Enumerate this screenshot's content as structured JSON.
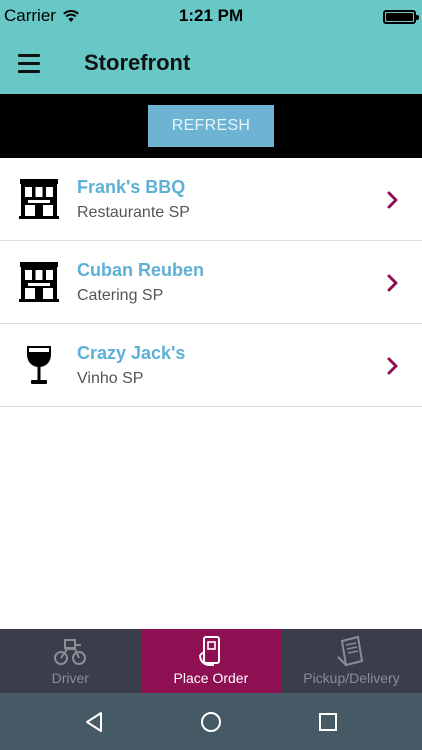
{
  "status_bar": {
    "carrier": "Carrier",
    "time": "1:21 PM",
    "icons": [
      "wifi-icon",
      "battery-icon"
    ]
  },
  "app_bar": {
    "title": "Storefront",
    "menu_icon": "hamburger-menu-icon"
  },
  "refresh": {
    "label": "REFRESH"
  },
  "stores": [
    {
      "name": "Frank's BBQ",
      "subtitle": "Restaurante SP",
      "icon": "storefront-building-icon"
    },
    {
      "name": "Cuban Reuben",
      "subtitle": "Catering SP",
      "icon": "storefront-building-icon"
    },
    {
      "name": "Crazy Jack's",
      "subtitle": "Vinho SP",
      "icon": "wine-glass-icon"
    }
  ],
  "tabs": [
    {
      "label": "Driver",
      "icon": "motorcycle-icon",
      "active": false
    },
    {
      "label": "Place Order",
      "icon": "phone-order-icon",
      "active": true
    },
    {
      "label": "Pickup/Delivery",
      "icon": "receipt-icon",
      "active": false
    }
  ],
  "colors": {
    "header": "#68c8c6",
    "refresh_button": "#6fb3d4",
    "store_name": "#5fb0d6",
    "chevron": "#8e0f52",
    "tab_bar": "#3a3d4a",
    "tab_active": "#8e0f52",
    "nav_bar": "#455a64"
  },
  "android_nav": [
    "back-icon",
    "home-icon",
    "recents-icon"
  ]
}
